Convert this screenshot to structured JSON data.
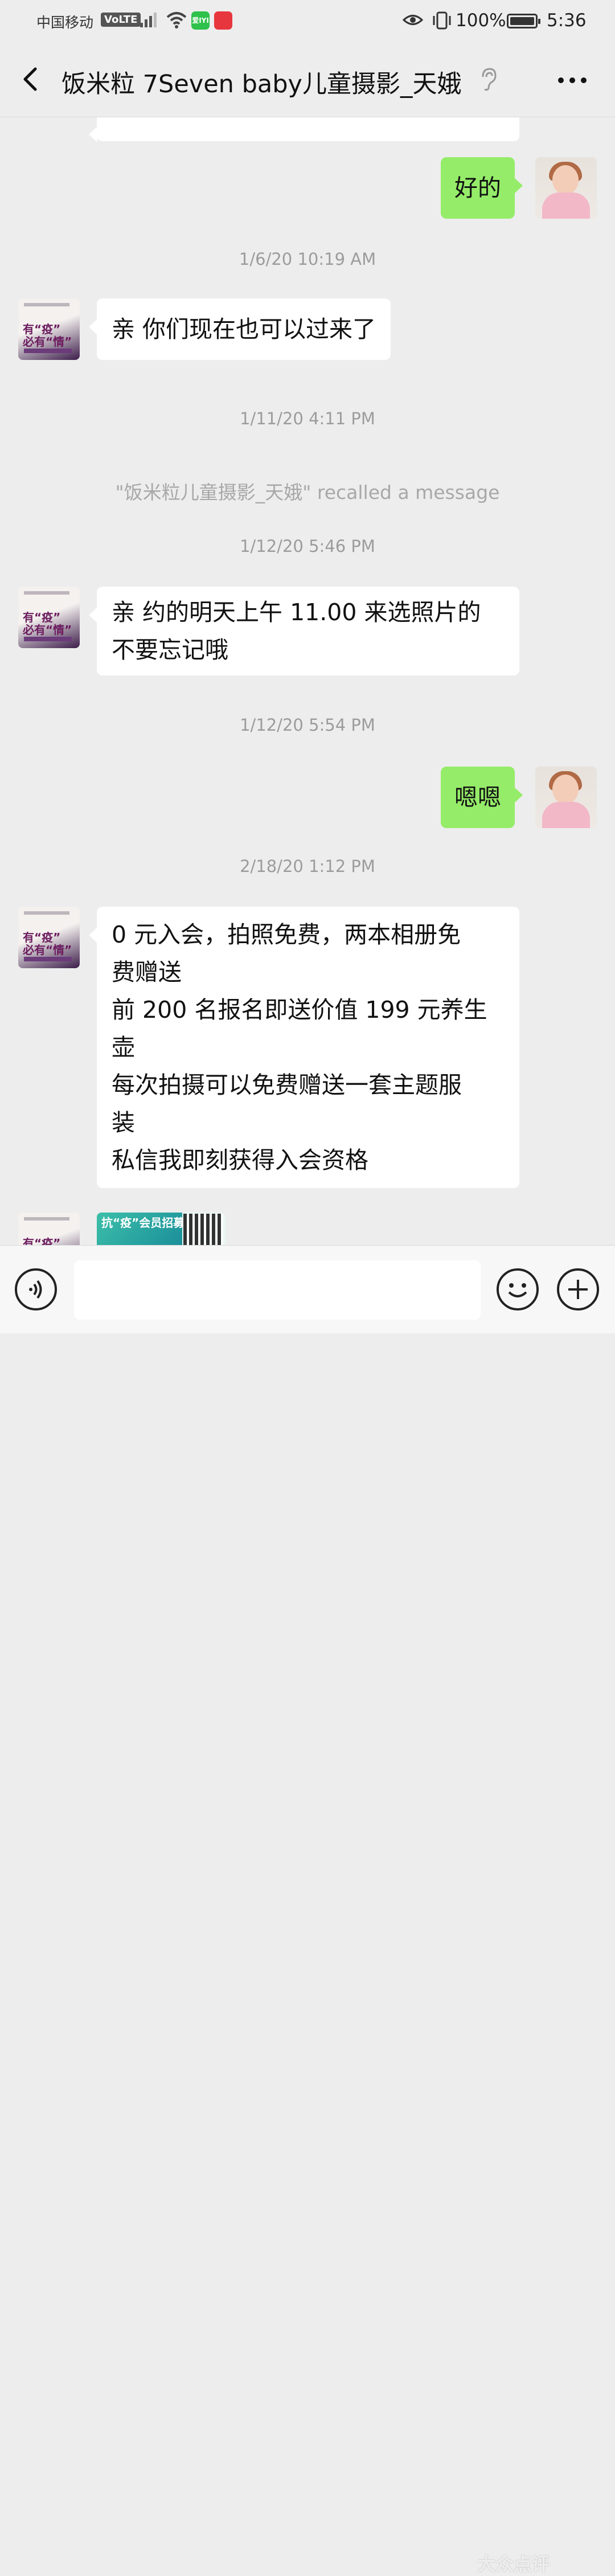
{
  "status_bar": {
    "carrier": "中国移动",
    "volte": "VoLTE",
    "app_badge": "爱IYI",
    "battery_percent": "100%",
    "time": "5:36"
  },
  "header": {
    "title": "饭米粒  7Seven baby儿童摄影_天娥",
    "icons": [
      "back-arrow-icon",
      "ear-icon",
      "more-icon"
    ]
  },
  "messages": {
    "top_partial": "",
    "m1": "好的",
    "t1": "1/6/20 10:19 AM",
    "m2": "亲 你们现在也可以过来了",
    "t2": "1/11/20 4:11 PM",
    "recall_notice": "\"饭米粒儿童摄影_天娥\" recalled a message",
    "t3": "1/12/20 5:46 PM",
    "m3_line1": "亲 约的明天上午 11.00 来选照片的",
    "m3_line2": "不要忘记哦",
    "t4": "1/12/20 5:54 PM",
    "m4": "嗯嗯",
    "t5": "2/18/20 1:12 PM",
    "m5_lines": [
      "0 元入会，拍照免费，两本相册免",
      "费赠送",
      "前 200 名报名即送价值 199 元养生",
      "壶",
      "每次拍摄可以免费赠送一套主题服",
      "装",
      "私信我即刻获得入会资格"
    ],
    "image_caption": "抗“疫”会员招募"
  },
  "avatars": {
    "shop_line1": "有“疫”",
    "shop_line2": "必有“情”"
  },
  "input_bar": {
    "placeholder": "",
    "icons": [
      "voice-icon",
      "emoji-icon",
      "plus-icon"
    ]
  },
  "watermark": "大众点评"
}
